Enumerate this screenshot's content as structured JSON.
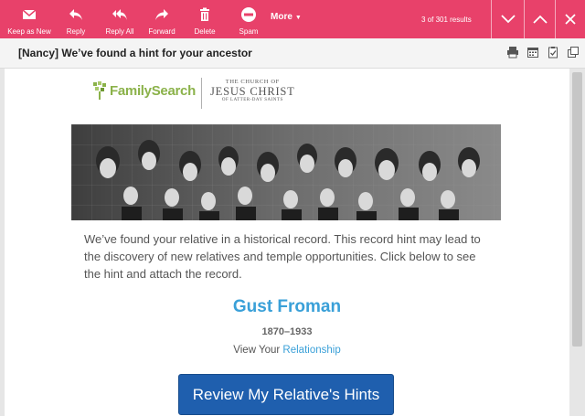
{
  "toolbar": {
    "keep_as_new": "Keep as New",
    "reply": "Reply",
    "reply_all": "Reply All",
    "forward": "Forward",
    "delete": "Delete",
    "spam": "Spam",
    "more": "More",
    "results": "3 of 301 results",
    "icons": [
      "envelope-icon",
      "reply-icon",
      "reply-all-icon",
      "forward-icon",
      "trash-icon",
      "spam-icon",
      "chevron-down-icon",
      "chevron-up-icon",
      "close-icon"
    ]
  },
  "message": {
    "subject": "[Nancy] We’ve found a hint for your ancestor",
    "icons": [
      "print-icon",
      "calendar-icon",
      "clipboard-icon",
      "popout-icon"
    ]
  },
  "email": {
    "logo_familysearch": "FamilySearch",
    "logo_church_line1": "THE CHURCH OF",
    "logo_church_line2": "JESUS CHRIST",
    "logo_church_line3": "OF LATTER-DAY SAINTS",
    "intro": "We’ve found your relative in a historical record. This record hint may lead to the discovery of new relatives and temple opportunities. Click below to see the hint and attach the record.",
    "ancestor_name": "Gust Froman",
    "years": "1870–1933",
    "view_your": "View Your ",
    "relationship_link": "Relationship",
    "cta": "Review My Relative's Hints"
  },
  "colors": {
    "toolbar": "#e8416a",
    "link": "#3aa0d8",
    "cta": "#1f5fae",
    "familysearch_green": "#8bb24a"
  }
}
